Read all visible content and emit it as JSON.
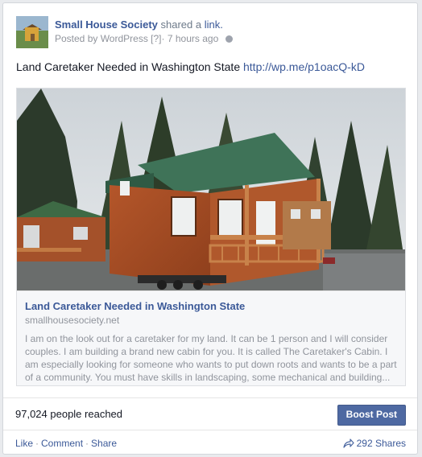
{
  "post": {
    "page_name": "Small House Society",
    "action_text": "shared a",
    "action_link": "link.",
    "posted_by": "Posted by WordPress",
    "posted_by_tag": "[?]",
    "separator": "·",
    "time": "7 hours ago",
    "message_text": "Land Caretaker Needed in Washington State",
    "message_url": "http://wp.me/p1oacQ-kD"
  },
  "attachment": {
    "image_icon": "photo-cabins",
    "title": "Land Caretaker Needed in Washington State",
    "domain": "smallhousesociety.net",
    "description": "I am on the look out for a caretaker for my land. It can be 1 person and I will consider couples. I am building a brand new cabin for you. It is called The Caretaker's Cabin. I am especially looking for someone who wants to put down roots and wants to be a part of a community. You must have skills in landscaping, some mechanical and building..."
  },
  "stats": {
    "reach": "97,024 people reached",
    "boost_label": "Boost Post"
  },
  "actions": {
    "like": "Like",
    "comment": "Comment",
    "share": "Share",
    "dot": "·",
    "shares_count": "292 Shares"
  },
  "colors": {
    "link": "#3b5998",
    "boost_bg": "#4e69a2"
  }
}
